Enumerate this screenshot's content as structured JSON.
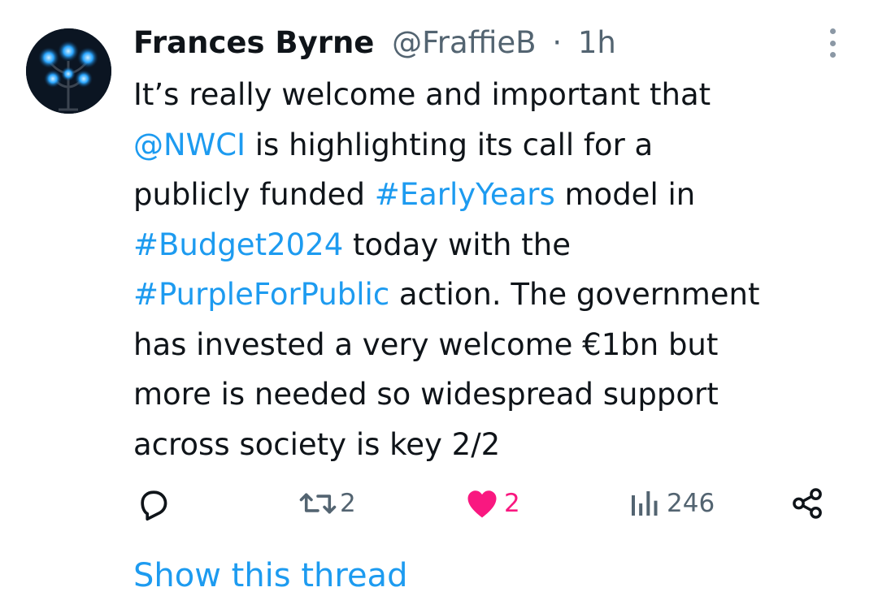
{
  "author": {
    "name": "Frances Byrne",
    "handle": "@FraffieB",
    "separator": "·",
    "time": "1h"
  },
  "tweet": {
    "segments": [
      [
        {
          "t": "It’s really welcome and important that",
          "link": false
        }
      ],
      [
        {
          "t": "@NWCI",
          "link": true
        },
        {
          "t": " is highlighting its call for a",
          "link": false
        }
      ],
      [
        {
          "t": "publicly funded ",
          "link": false
        },
        {
          "t": "#EarlyYears",
          "link": true
        },
        {
          "t": " model in",
          "link": false
        }
      ],
      [
        {
          "t": "#Budget2024",
          "link": true
        },
        {
          "t": " today with the",
          "link": false
        }
      ],
      [
        {
          "t": "#PurpleForPublic",
          "link": true
        },
        {
          "t": " action. The government",
          "link": false
        }
      ],
      [
        {
          "t": "has invested a very welcome €1bn but",
          "link": false
        }
      ],
      [
        {
          "t": "more is needed so widespread support",
          "link": false
        }
      ],
      [
        {
          "t": "across society is key 2/2",
          "link": false
        }
      ]
    ]
  },
  "actions": {
    "reply_count": "",
    "retweet_count": "2",
    "like_count": "2",
    "view_count": "246"
  },
  "icons": {
    "avatar": "lamppost-photo",
    "more": "more-vertical-icon",
    "reply": "reply-icon",
    "retweet": "retweet-icon",
    "like": "heart-filled-icon",
    "views": "views-bar-chart-icon",
    "share": "share-icon"
  },
  "colors": {
    "link": "#1d9bf0",
    "text": "#0f1419",
    "secondary": "#536471",
    "like": "#f91880"
  },
  "footer": {
    "show_thread": "Show this thread"
  }
}
